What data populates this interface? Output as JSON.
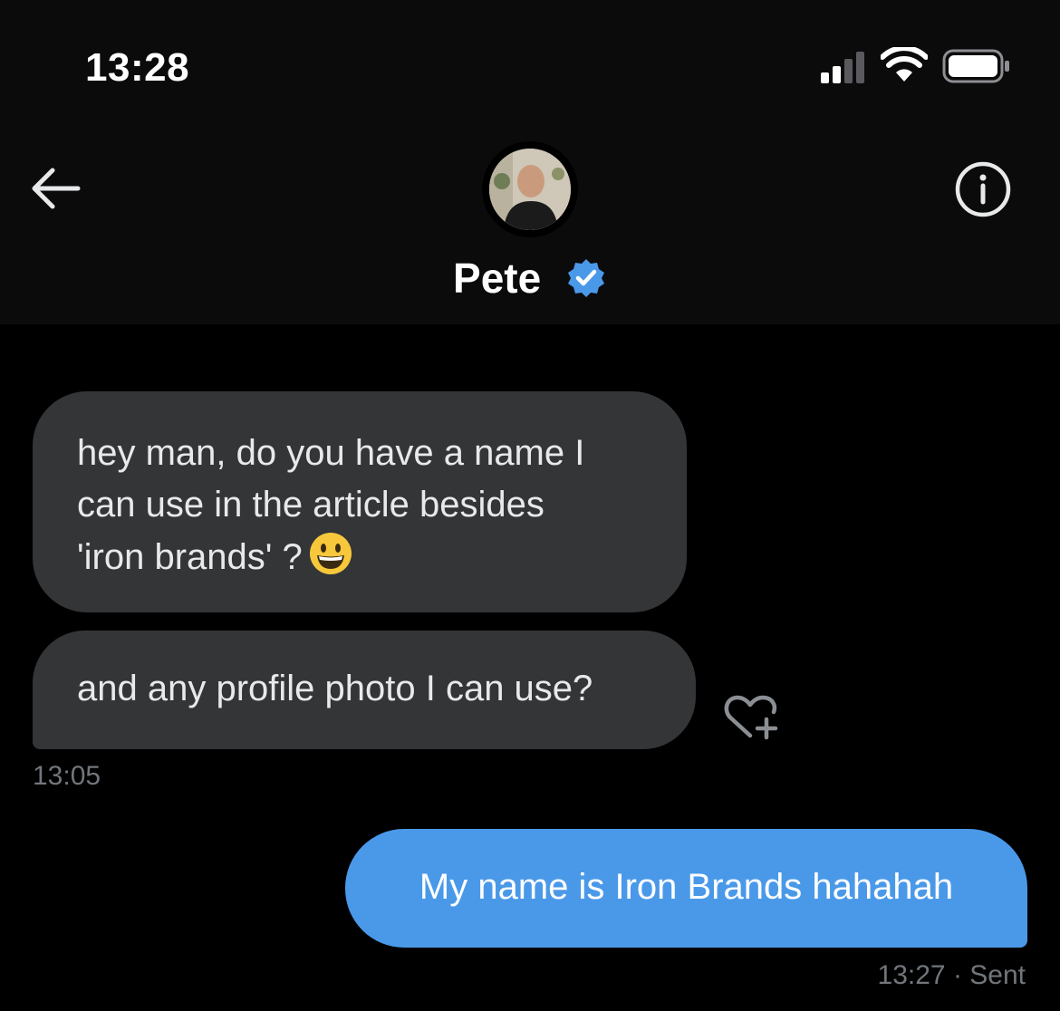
{
  "status_bar": {
    "time": "13:28",
    "signal_icon": "cellular-signal-icon",
    "wifi_icon": "wifi-icon",
    "battery_icon": "battery-icon"
  },
  "header": {
    "back_icon": "arrow-left-icon",
    "info_icon": "info-icon",
    "contact_name": "Pete",
    "verified_icon": "verified-badge-icon",
    "verified_color": "#4a99e9"
  },
  "messages": {
    "incoming": [
      {
        "lines": [
          "hey man, do you have a name I",
          "can use in the article besides",
          "'iron brands' ?"
        ],
        "emoji": "grinning-face-emoji"
      },
      {
        "lines": [
          "and any profile photo I can use?"
        ]
      }
    ],
    "incoming_time": "13:05",
    "react_icon": "heart-plus-icon",
    "outgoing": [
      {
        "text": "My name is Iron Brands hahahah"
      }
    ],
    "outgoing_time": "13:27",
    "outgoing_status": "Sent"
  },
  "colors": {
    "background": "#000000",
    "header_background": "#0b0b0c",
    "incoming_bubble": "#333537",
    "outgoing_bubble": "#4a99e9",
    "meta_text": "#71767b"
  }
}
